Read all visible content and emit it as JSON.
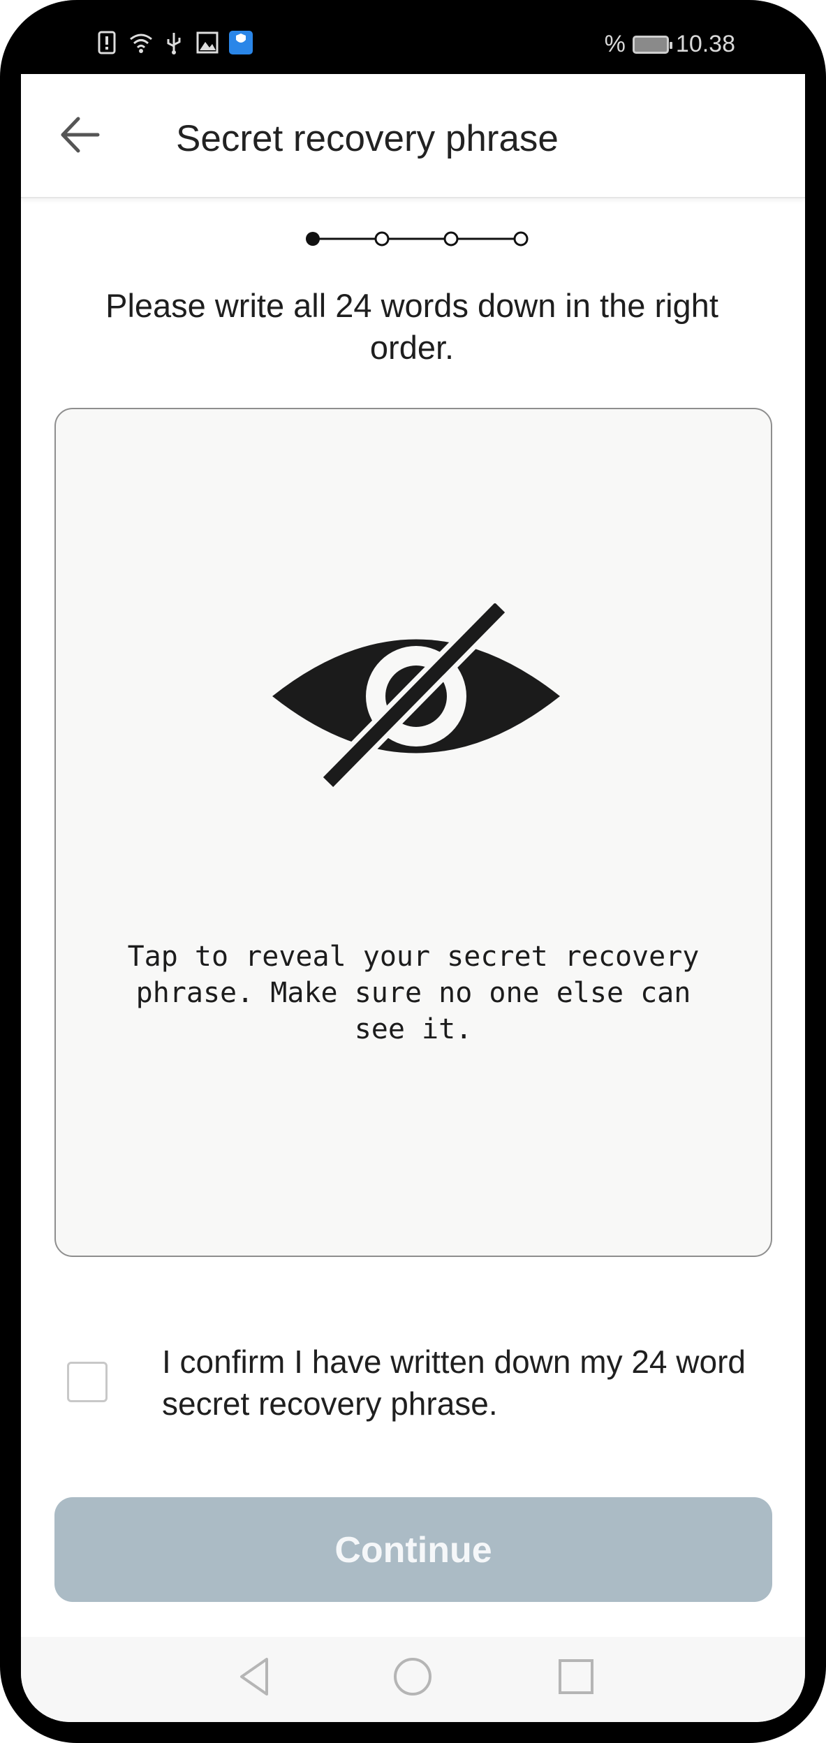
{
  "status_bar": {
    "battery_percent": "%",
    "time": "10.38",
    "icons": [
      "sim-alert-icon",
      "wifi-icon",
      "usb-icon",
      "image-icon",
      "app-notification-icon"
    ]
  },
  "app_bar": {
    "title": "Secret recovery phrase",
    "back_icon": "arrow-left-icon"
  },
  "stepper": {
    "total_steps": 4,
    "current_step": 1
  },
  "instruction": "Please write all 24 words down in the right order.",
  "reveal_card": {
    "icon": "eye-slash-icon",
    "text": "Tap to reveal your secret recovery\nphrase. Make sure no one else can\nsee it."
  },
  "confirm": {
    "checked": false,
    "label": "I confirm I have written down my 24 word secret recovery phrase."
  },
  "continue_button": {
    "label": "Continue",
    "enabled": false
  },
  "nav_bar": {
    "items": [
      "back-triangle-icon",
      "home-circle-icon",
      "recents-square-icon"
    ]
  },
  "colors": {
    "button_disabled": "#abbbc5",
    "card_background": "#f8f8f7",
    "text": "#1e1e1e"
  }
}
